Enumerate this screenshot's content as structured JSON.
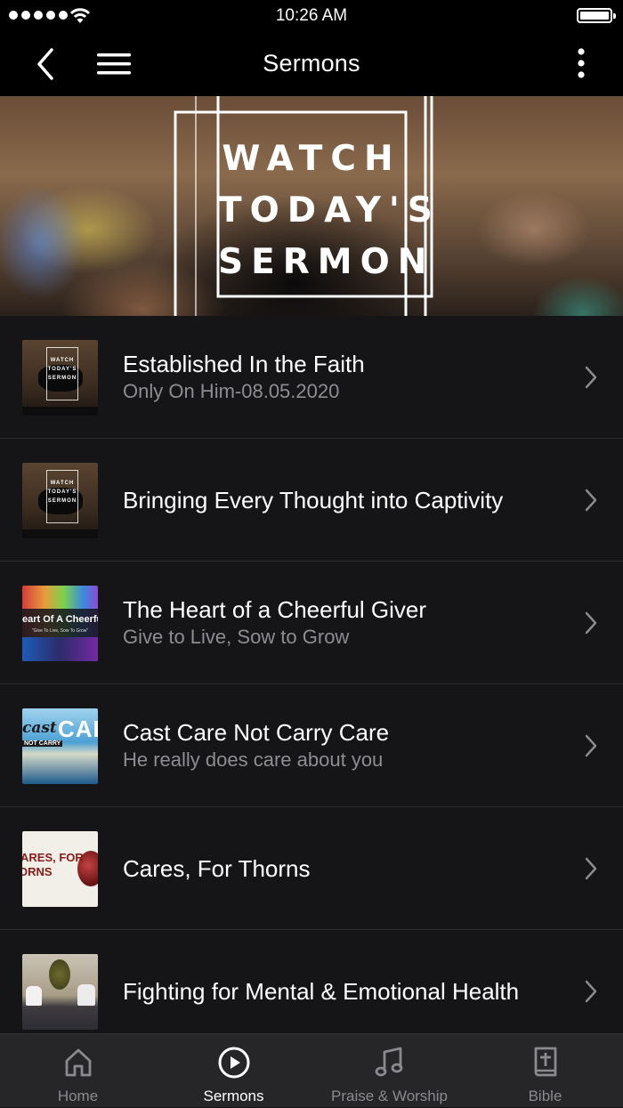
{
  "status_bar": {
    "time": "10:26 AM"
  },
  "navbar": {
    "title": "Sermons"
  },
  "banner": {
    "lines": [
      "WATCH",
      "TODAY'S",
      "SERMON"
    ]
  },
  "sermons": [
    {
      "title": "Established In the Faith",
      "subtitle": "Only On Him-08.05.2020",
      "thumb_text": [
        "WATCH",
        "TODAY'S",
        "SERMON"
      ]
    },
    {
      "title": "Bringing Every Thought into Captivity",
      "subtitle": "",
      "thumb_text": [
        "WATCH",
        "TODAY'S",
        "SERMON"
      ]
    },
    {
      "title": "The Heart of a Cheerful Giver",
      "subtitle": "Give to Live, Sow to Grow",
      "thumb_text": [
        "eart Of A Cheerful",
        "\"Give To Live, Sow To Grow\""
      ]
    },
    {
      "title": "Cast Care Not Carry Care",
      "subtitle": "He really does care about you",
      "thumb_text": [
        "cast",
        "CAR",
        "NOT CARRY"
      ]
    },
    {
      "title": "Cares, For Thorns",
      "subtitle": "",
      "thumb_text": [
        "ARES, FOR",
        "ORNS"
      ]
    },
    {
      "title": "Fighting for Mental & Emotional Health",
      "subtitle": "",
      "thumb_text": []
    }
  ],
  "tabs": [
    {
      "label": "Home",
      "icon": "home-icon",
      "active": false
    },
    {
      "label": "Sermons",
      "icon": "play-circle-icon",
      "active": true
    },
    {
      "label": "Praise & Worship",
      "icon": "music-note-icon",
      "active": false
    },
    {
      "label": "Bible",
      "icon": "bible-icon",
      "active": false
    }
  ],
  "colors": {
    "background": "#151517",
    "bar": "#000000",
    "tabbar": "#262628",
    "subtitle": "#8d8d92",
    "inactive_tab": "#8a8a8f"
  }
}
